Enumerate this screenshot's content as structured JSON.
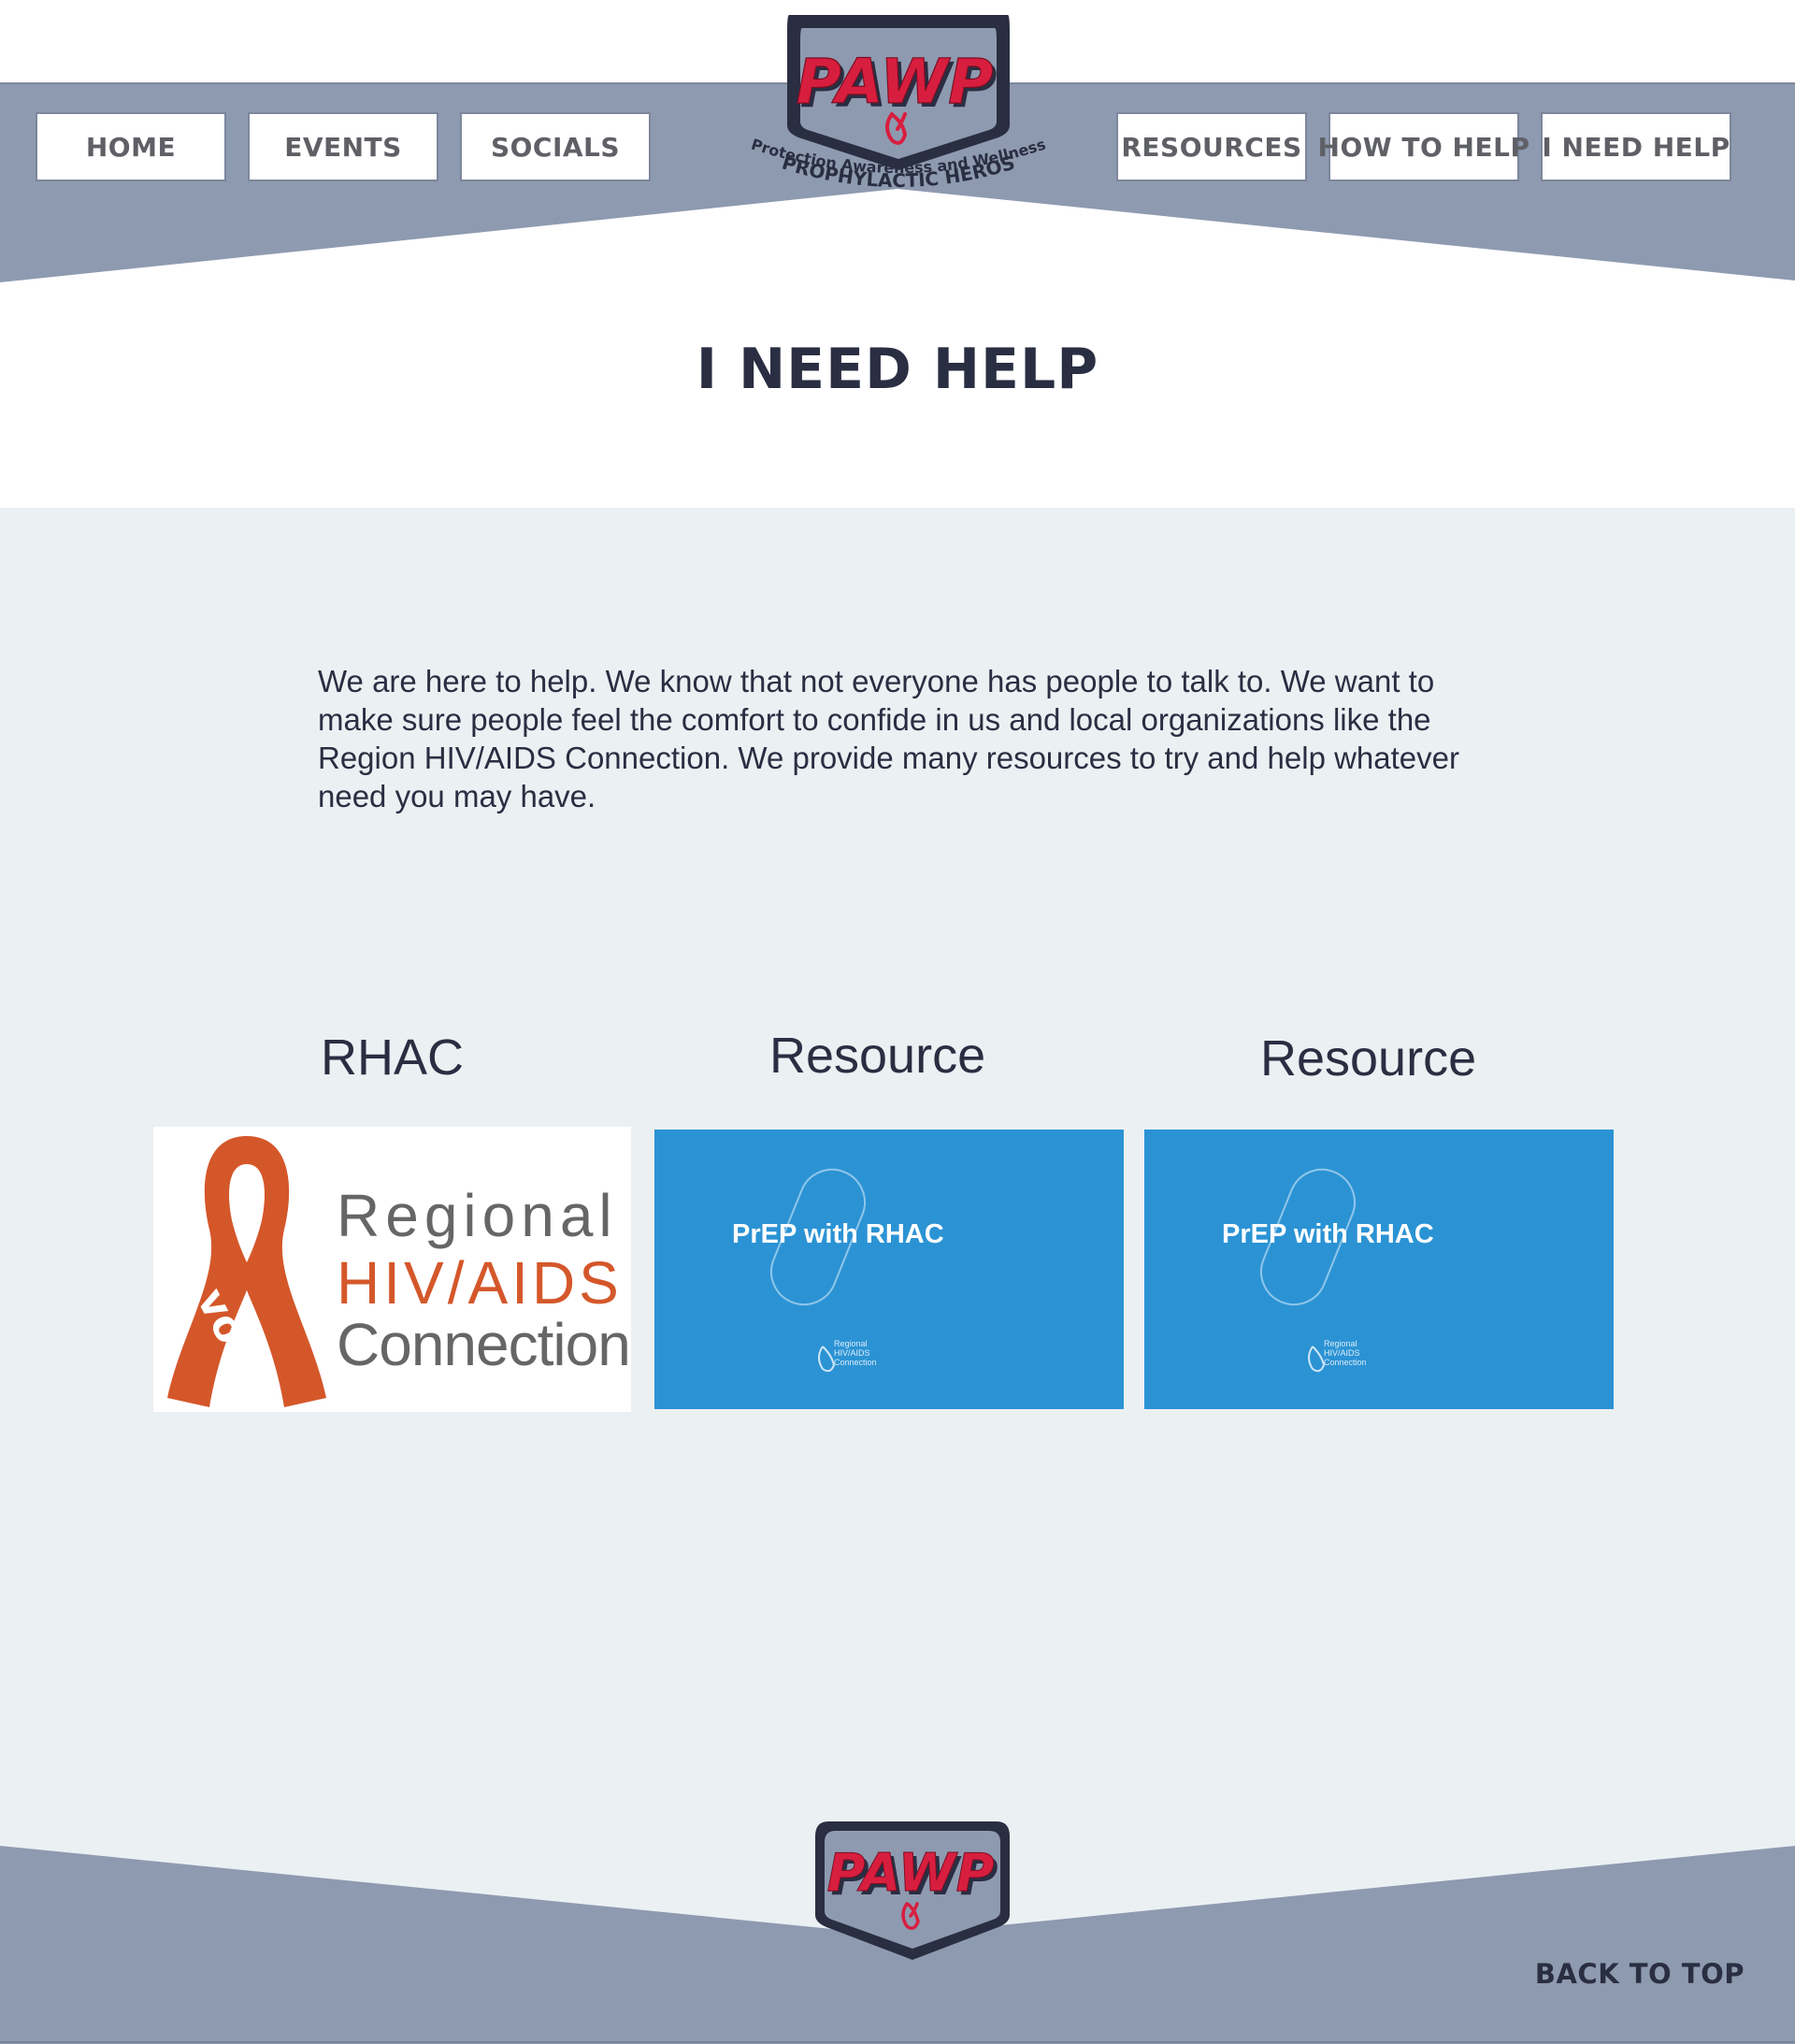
{
  "nav": {
    "left": [
      "HOME",
      "EVENTS",
      "SOCIALS"
    ],
    "right": [
      "RESOURCES",
      "HOW TO HELP",
      "I NEED HELP"
    ]
  },
  "logo": {
    "wordmark": "PAWP",
    "tagline_top": "Protection Awareness and Wellness",
    "tagline_bottom": "PROPHYLACTIC HEROS"
  },
  "page": {
    "title": "I NEED HELP",
    "intro": "We are here to help. We know that not everyone has people to talk to. We want to make sure people feel the comfort to confide in us and local organizations like the Region HIV/AIDS Connection. We provide many resources to try and help whatever need you may have."
  },
  "cards": [
    {
      "heading": "RHAC",
      "line1": "Regional",
      "line2": "HIV/AIDS",
      "line3": "Connection",
      "ribbon_word": "voice"
    },
    {
      "heading": "Resource",
      "banner_text": "PrEP with RHAC",
      "mini_logo": "Regional HIV/AIDS Connection"
    },
    {
      "heading": "Resource",
      "banner_text": "PrEP with RHAC",
      "mini_logo": "Regional HIV/AIDS Connection"
    }
  ],
  "footer": {
    "back_to_top": "BACK TO TOP"
  },
  "colors": {
    "band_gray": "#8e9ab0",
    "navy": "#2a2e42",
    "pawp_red": "#d81e3f",
    "content_bg": "#ebf0f3",
    "rhac_orange": "#d4572a",
    "prep_blue": "#2b93d4"
  }
}
